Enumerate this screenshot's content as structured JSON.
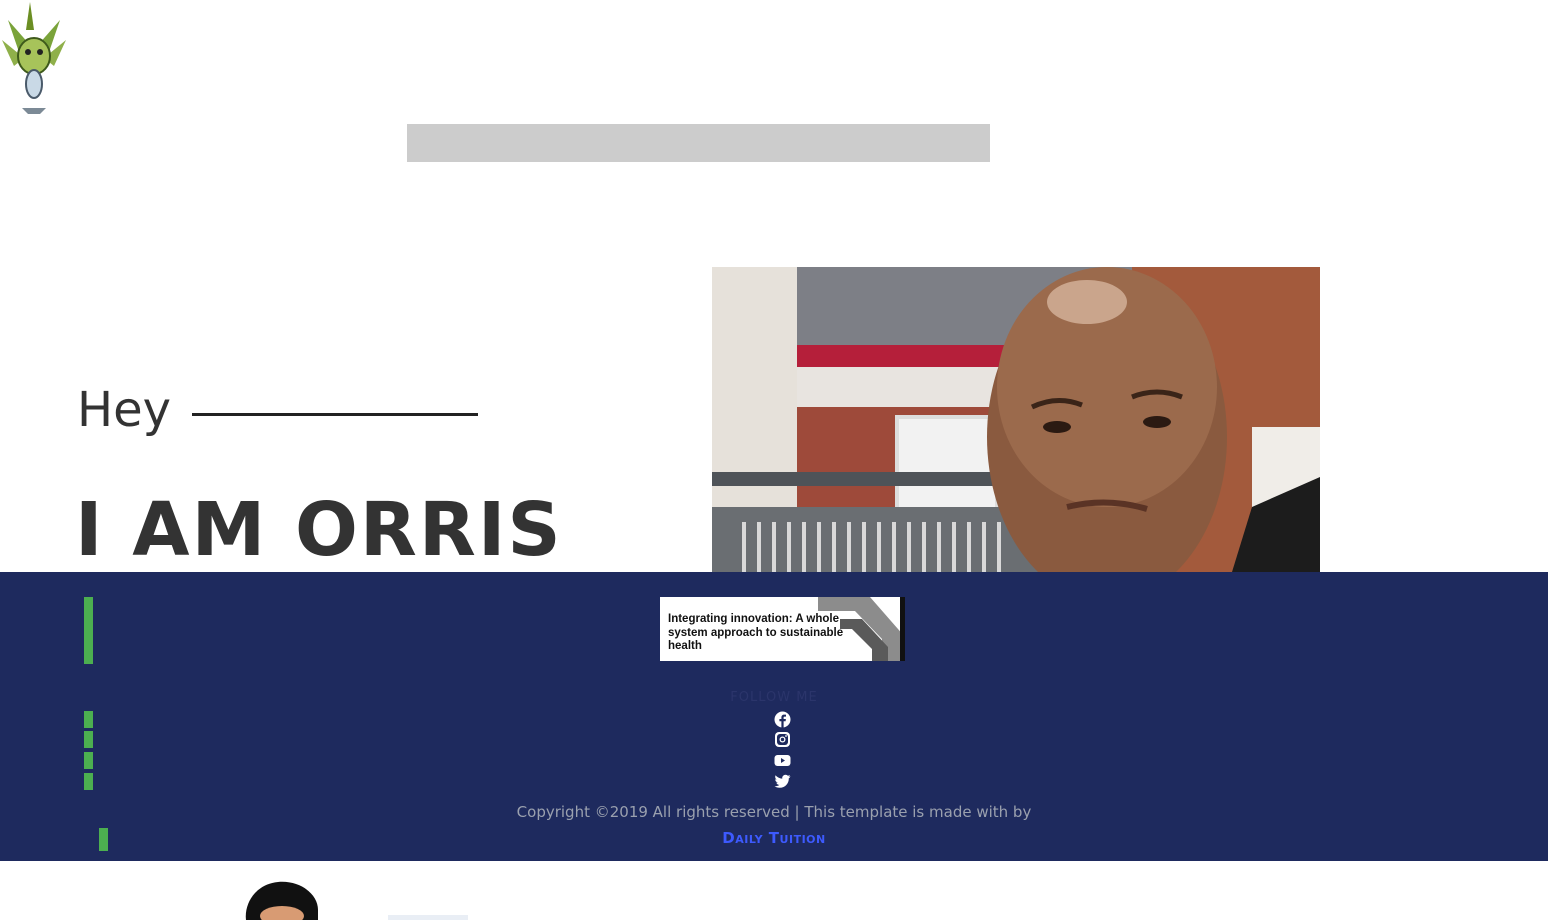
{
  "header": {
    "logo_icon": "dragon-crest-logo-icon",
    "search_bar": ""
  },
  "hero": {
    "greeting": "Hey",
    "headline": "I AM ORRIS",
    "photo_icon": "profile-photo"
  },
  "footer": {
    "banner_text": "Integrating innovation: A whole system approach to sustainable health",
    "follow_label": "FOLLOW ME",
    "social_icons": [
      "facebook-icon",
      "instagram-icon",
      "youtube-icon",
      "twitter-icon"
    ],
    "copyright": "Copyright ©2019 All rights reserved | This template is made with by",
    "credit_link": "Daily Tuition"
  },
  "colors": {
    "footer_bg": "#1e2a5e",
    "accent_green": "#4caf50",
    "link_blue": "#3d5afe",
    "text_dark": "#333333"
  }
}
